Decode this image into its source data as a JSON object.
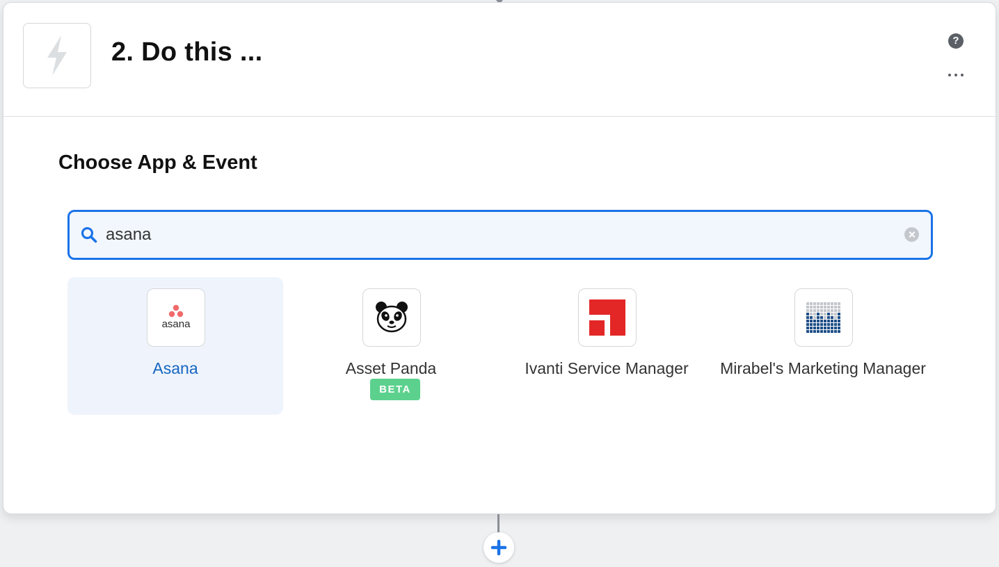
{
  "step": {
    "title": "2. Do this ..."
  },
  "section": {
    "title": "Choose App & Event"
  },
  "search": {
    "value": "asana",
    "placeholder": ""
  },
  "apps": [
    {
      "name": "Asana",
      "logo_text": "asana",
      "selected": true
    },
    {
      "name": "Asset Panda",
      "badge": "BETA",
      "selected": false
    },
    {
      "name": "Ivanti Service Manager",
      "selected": false
    },
    {
      "name": "Mirabel's Marketing Manager",
      "selected": false
    }
  ],
  "icons": [
    "bolt-icon",
    "help-icon",
    "more-icon",
    "search-icon",
    "clear-icon",
    "plus-icon"
  ],
  "colors": {
    "accent": "#1a73e8",
    "beta_badge": "#5bd18d",
    "asana_brand": "#f06a6a",
    "ivanti_red": "#e22726",
    "mirabel_blue": "#1f4f87"
  }
}
